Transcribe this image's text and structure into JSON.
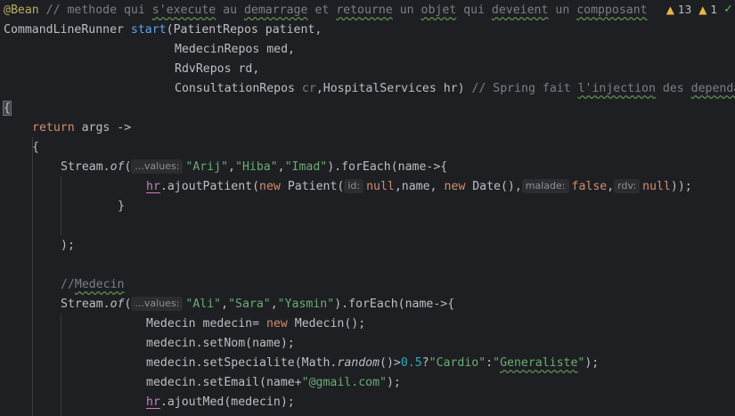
{
  "inspections": {
    "warnings": "13",
    "weak_warnings": "1",
    "colors": {
      "warning": "#e5b64b",
      "ok": "#5fb865"
    }
  },
  "code": {
    "l1_annotation": "@Bean",
    "l1_comment_a": "// methode qui ",
    "l1_comment_b": "s'execute",
    "l1_comment_c": " au ",
    "l1_comment_d": "demarrage",
    "l1_comment_e": " et ",
    "l1_comment_f": "retourne",
    "l1_comment_g": " un ",
    "l1_comment_h": "objet",
    "l1_comment_i": " qui ",
    "l1_comment_j": "deveient",
    "l1_comment_k": " un ",
    "l1_comment_l": "compposant",
    "l2_type": "CommandLineRunner ",
    "l2_method": "start",
    "l2_rest": "(PatientRepos patient,",
    "l3": "MedecinRepos med,",
    "l4": "RdvRepos rd,",
    "l5_a": "ConsultationRepos ",
    "l5_cr": "cr",
    "l5_b": ",HospitalServices hr) ",
    "l5_comment_a": "// Spring fait ",
    "l5_comment_b": "l'injection",
    "l5_comment_c": " des ",
    "l5_comment_d": "dependances",
    "l6": "{",
    "l7_return": "return",
    "l7_rest": " args ->",
    "l8": "{",
    "l9_a": "Stream.",
    "l9_of": "of",
    "l9_b": "(",
    "l9_hint": "...values:",
    "l9_s1": "\"Arij\"",
    "l9_c1": ",",
    "l9_s2": "\"Hiba\"",
    "l9_c2": ",",
    "l9_s3": "\"Imad\"",
    "l9_c": ").forEach(name->{",
    "l10_hr": "hr",
    "l10_a": ".ajoutPatient(",
    "l10_new": "new",
    "l10_b": " Patient(",
    "l10_hint_id": "id:",
    "l10_null1": "null",
    "l10_c": ",name, ",
    "l10_new2": "new",
    "l10_d": " Date(),",
    "l10_hint_malade": "malade:",
    "l10_false": "false",
    "l10_e": ",",
    "l10_hint_rdv": "rdv:",
    "l10_null2": "null",
    "l10_f": "));",
    "l11": "}",
    "l13": ");",
    "l15_cmt_a": "//",
    "l15_cmt_b": "Medecin",
    "l16_a": "Stream.",
    "l16_of": "of",
    "l16_b": "(",
    "l16_hint": "...values:",
    "l16_s1": "\"Ali\"",
    "l16_c1": ",",
    "l16_s2": "\"Sara\"",
    "l16_c2": ",",
    "l16_s3": "\"Yasmin\"",
    "l16_c": ").forEach(name->{",
    "l17_a": "Medecin medecin= ",
    "l17_new": "new",
    "l17_b": " Medecin();",
    "l18": "medecin.setNom(name);",
    "l19_a": "medecin.setSpecialite(Math.",
    "l19_random": "random",
    "l19_b": "()>",
    "l19_num": "0.5",
    "l19_c": "?",
    "l19_s1": "\"Cardio\"",
    "l19_d": ":",
    "l19_s2a": "\"",
    "l19_s2b": "Generaliste",
    "l19_s2c": "\"",
    "l19_e": ");",
    "l20_a": "medecin.setEmail(name+",
    "l20_s": "\"@gmail.com\"",
    "l20_b": ");",
    "l21_hr": "hr",
    "l21_a": ".ajoutMed(medecin);"
  }
}
